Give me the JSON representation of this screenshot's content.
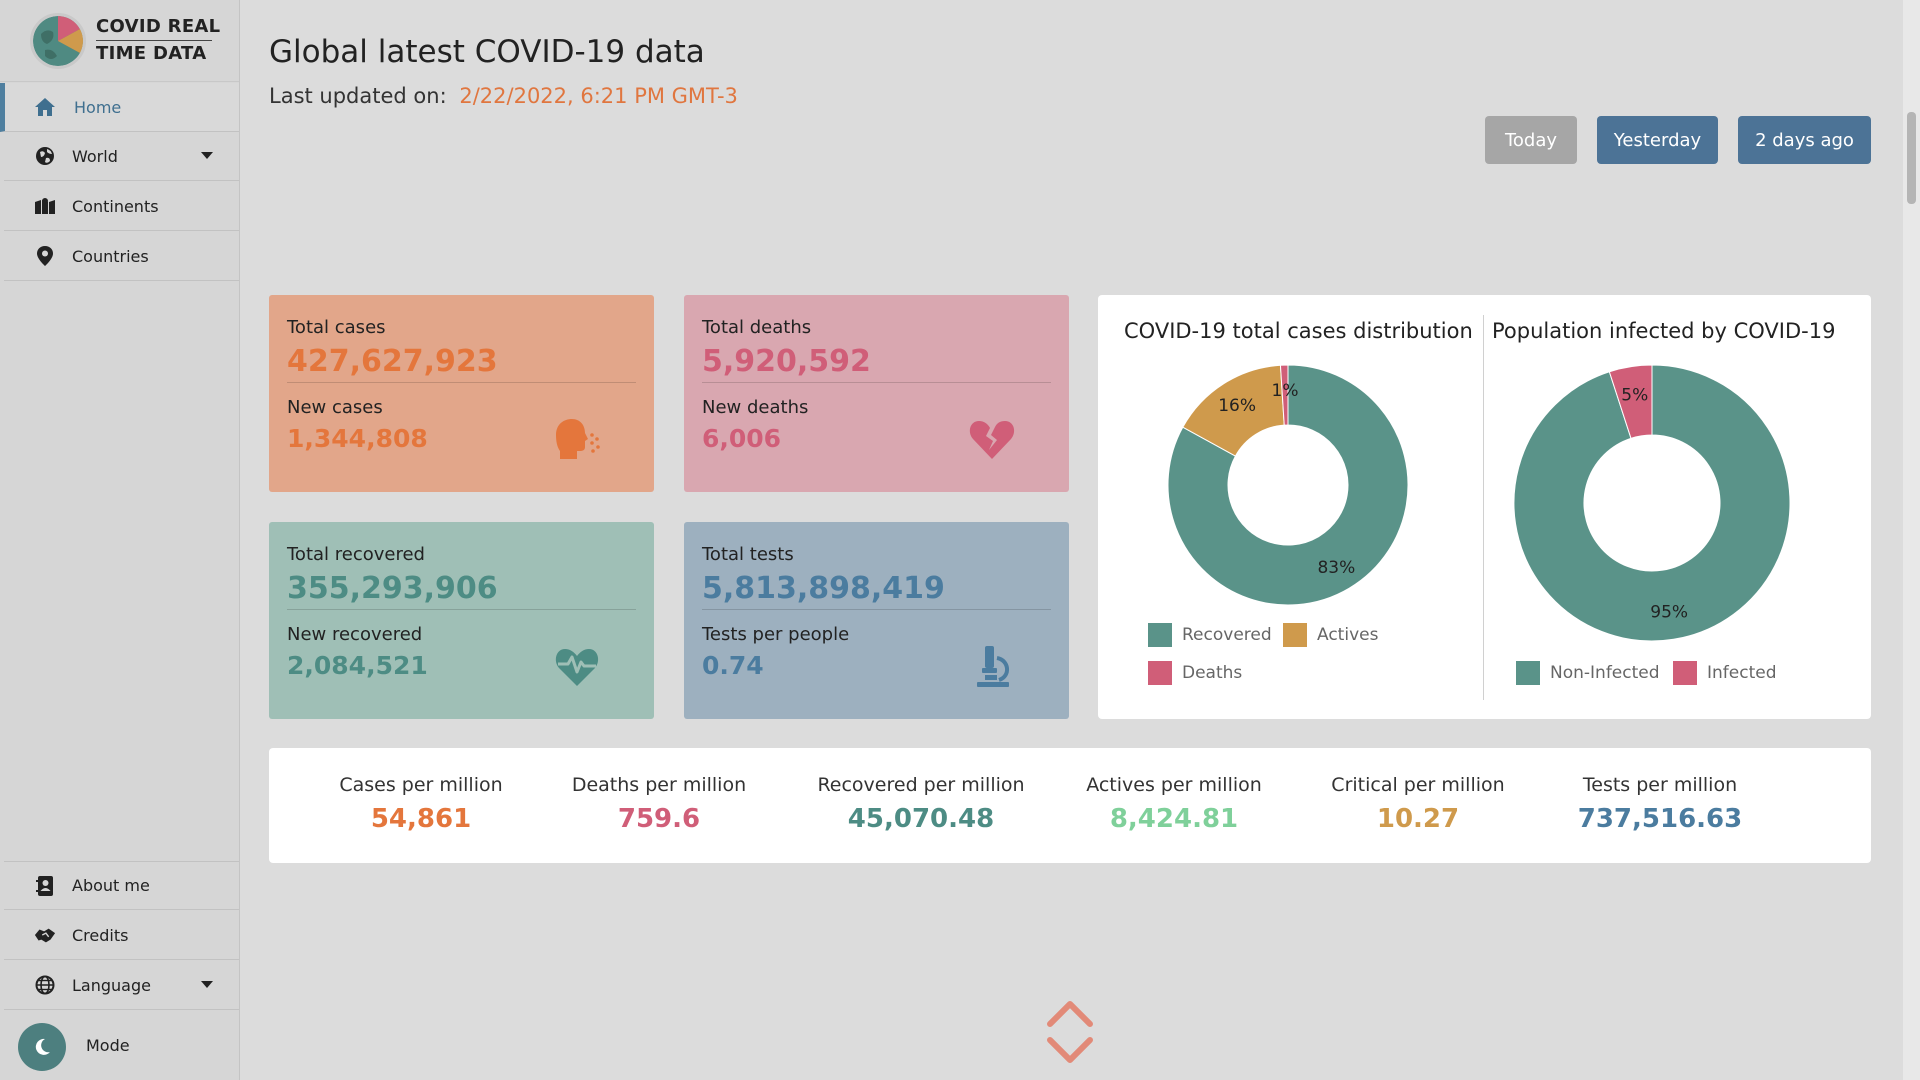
{
  "app": {
    "logo_line1": "COVID REAL",
    "logo_line2": "TIME DATA"
  },
  "sidebar": {
    "items": [
      {
        "label": "Home",
        "icon": "home-icon",
        "active": true
      },
      {
        "label": "World",
        "icon": "globe-icon"
      },
      {
        "label": "Continents",
        "icon": "map-icon"
      },
      {
        "label": "Countries",
        "icon": "map-pin-icon"
      }
    ],
    "bottom_items": [
      {
        "label": "About me",
        "icon": "contact-book-icon"
      },
      {
        "label": "Credits",
        "icon": "handshake-icon"
      },
      {
        "label": "Language",
        "icon": "globe-language-icon"
      }
    ],
    "mode_label": "Mode"
  },
  "header": {
    "title": "Global latest COVID-19 data",
    "updated_label": "Last updated on:",
    "updated_value": "2/22/2022, 6:21 PM GMT-3"
  },
  "day_buttons": {
    "today": "Today",
    "yesterday": "Yesterday",
    "two_days": "2 days ago"
  },
  "cards": {
    "cases": {
      "label": "Total cases",
      "value": "427,627,923",
      "sub_label": "New cases",
      "sub_value": "1,344,808"
    },
    "deaths": {
      "label": "Total deaths",
      "value": "5,920,592",
      "sub_label": "New deaths",
      "sub_value": "6,006"
    },
    "recovered": {
      "label": "Total recovered",
      "value": "355,293,906",
      "sub_label": "New recovered",
      "sub_value": "2,084,521"
    },
    "tests": {
      "label": "Total tests",
      "value": "5,813,898,419",
      "sub_label": "Tests per people",
      "sub_value": "0.74"
    }
  },
  "chart_data": [
    {
      "type": "pie",
      "title": "COVID-19 total cases distribution",
      "categories": [
        "Recovered",
        "Actives",
        "Deaths"
      ],
      "values": [
        83,
        16,
        1
      ],
      "labels": [
        "83%",
        "16%",
        "1%"
      ],
      "colors": [
        "#5a9389",
        "#cf9a4c",
        "#d05e78"
      ],
      "donut": true,
      "legend": "bottom"
    },
    {
      "type": "pie",
      "title": "Population infected by COVID-19",
      "categories": [
        "Non-Infected",
        "Infected"
      ],
      "values": [
        95,
        5
      ],
      "labels": [
        "95%",
        "5%"
      ],
      "colors": [
        "#5a9389",
        "#d05e78"
      ],
      "donut": true,
      "legend": "bottom"
    }
  ],
  "stats": [
    {
      "label": "Cases per million",
      "value": "54,861",
      "color": "#e4763c"
    },
    {
      "label": "Deaths per million",
      "value": "759.6",
      "color": "#d05e78"
    },
    {
      "label": "Recovered per million",
      "value": "45,070.48",
      "color": "#4d8c84"
    },
    {
      "label": "Actives per million",
      "value": "8,424.81",
      "color": "#7fd09a"
    },
    {
      "label": "Critical per million",
      "value": "10.27",
      "color": "#cf9a4c"
    },
    {
      "label": "Tests per million",
      "value": "737,516.63",
      "color": "#4b7c9f"
    }
  ],
  "colors": {
    "accent": "#4c7396",
    "cases": "#e4763c",
    "deaths": "#d05e78",
    "recovered": "#4d8c84",
    "tests": "#4b7c9f"
  }
}
